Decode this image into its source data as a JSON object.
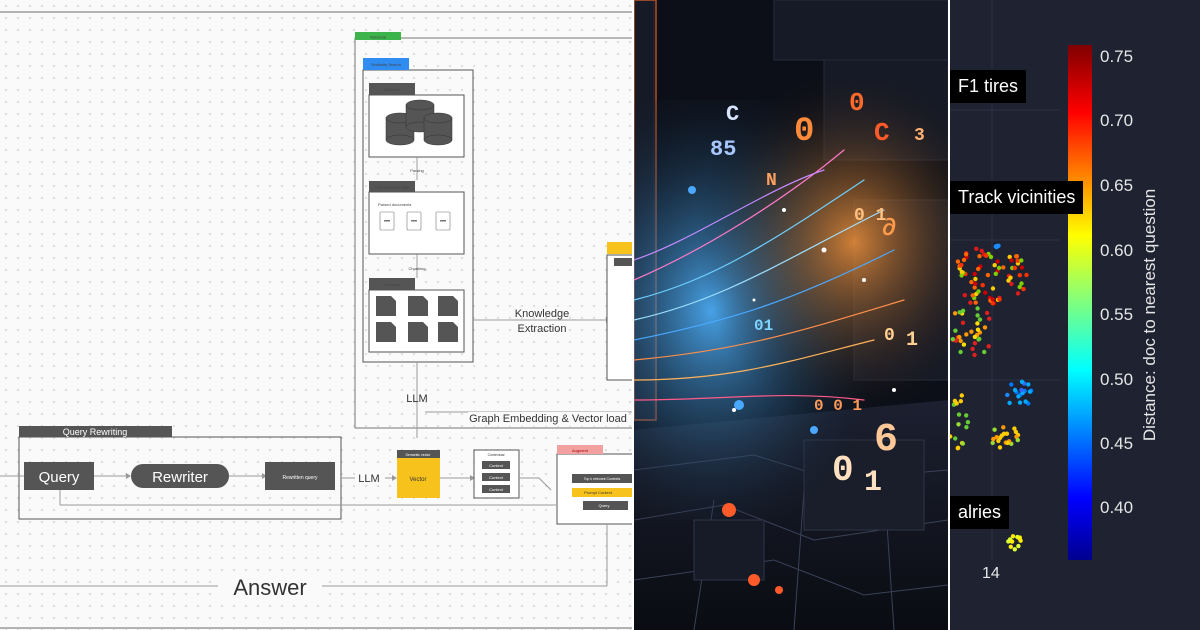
{
  "diagram": {
    "retrieval_label": "Retrieval",
    "similarity_search_label": "Similarity Search",
    "data_info_label": "Data info",
    "parsing_label": "Parsing",
    "preprocessed_data_label": "Preprocessed data",
    "parsed_documents_label": "Parsed documents",
    "chunking_mid_label": "Chunking",
    "chunking_label": "Chunking",
    "knowledge_extraction_line1": "Knowledge",
    "knowledge_extraction_line2": "Extraction",
    "llm_top_label": "LLM",
    "graph_embedding_label": "Graph Embedding & Vector load",
    "query_rewriting_label": "Query Rewriting",
    "query_label": "Query",
    "rewriter_label": "Rewriter",
    "rewritten_query_label": "Rewritten query",
    "llm_mid_label": "LLM",
    "semantic_vector_label": "Semantic vector",
    "vector_label": "Vector",
    "context_header_label": "Contextual",
    "context_items": [
      "Context",
      "Context",
      "Context"
    ],
    "augment_label": "Augment",
    "augment_items": [
      "Top k relevant Contexts",
      "Prompt Context",
      "Query"
    ],
    "answer_label": "Answer",
    "colors": {
      "yellow": "#f7c21c",
      "green": "#3cb44b",
      "blue": "#2f8cf0",
      "dark_box": "#555555",
      "pink": "#f3a0a0"
    }
  },
  "ai_image": {
    "icon_name": "ai-data-stream-illustration"
  },
  "plot": {
    "labels": [
      "F1 tires",
      "Track vicinities",
      "alries"
    ],
    "x_tick": "14",
    "colorbar_title": "Distance: doc to nearest question",
    "colorbar_ticks": [
      "0.75",
      "0.70",
      "0.65",
      "0.60",
      "0.55",
      "0.50",
      "0.45",
      "0.40"
    ]
  }
}
